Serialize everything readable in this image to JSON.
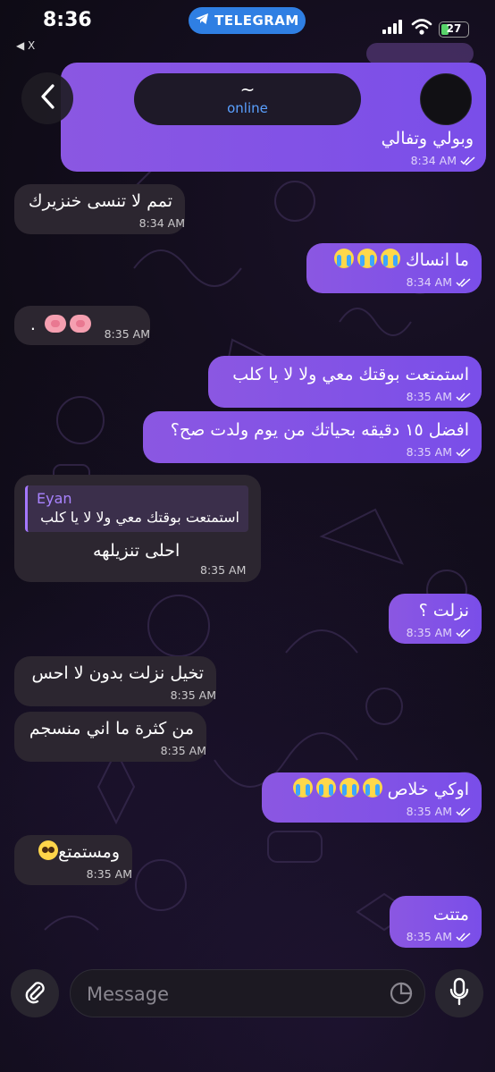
{
  "status_bar": {
    "time": "8:36",
    "back_label": "◀ X",
    "app_pill": "TELEGRAM",
    "battery": "27"
  },
  "header": {
    "contact_name": "~",
    "contact_status": "online"
  },
  "top_partial": {
    "text": "وبولي وتفالي",
    "time": "8:34 AM"
  },
  "messages": [
    {
      "dir": "in",
      "text": "تمم لا تنسى خنزيرك",
      "time": "8:34 AM"
    },
    {
      "dir": "out",
      "text": "ما انساك",
      "emoji": "crying-face x3",
      "time": "8:34 AM"
    },
    {
      "dir": "in",
      "text": ".",
      "emoji": "pig-nose x2",
      "time": "8:35 AM"
    },
    {
      "dir": "out",
      "text": "استمتعت بوقتك معي ولا لا يا كلب",
      "time": "8:35 AM"
    },
    {
      "dir": "out",
      "text": "افضل ١٥ دقيقه بحياتك من يوم ولدت صح؟",
      "time": "8:35 AM"
    },
    {
      "dir": "in",
      "reply_name": "Eyan",
      "reply_text": "استمتعت بوقتك معي ولا لا يا كلب",
      "text": "احلى تنزيلهه",
      "time": "8:35 AM"
    },
    {
      "dir": "out",
      "text": "نزلت ؟",
      "time": "8:35 AM"
    },
    {
      "dir": "in",
      "text": "تخيل نزلت بدون لا احس",
      "time": "8:35 AM"
    },
    {
      "dir": "in",
      "text": "من كثرة ما اني منسجم",
      "time": "8:35 AM"
    },
    {
      "dir": "out",
      "text": "اوكي خلاص",
      "emoji": "crying-face x4",
      "time": "8:35 AM"
    },
    {
      "dir": "in",
      "text": "ومستمتع",
      "emoji": "pleading-face",
      "time": "8:35 AM"
    },
    {
      "dir": "out",
      "text": "متتت",
      "time": "8:35 AM"
    }
  ],
  "composer": {
    "placeholder": "Message"
  },
  "colors": {
    "outgoing_bubble": "#8552e6",
    "incoming_bubble": "#2c2630",
    "accent_blue": "#2f7fe3",
    "online": "#5aa0ff"
  },
  "icons": [
    "telegram-plane-icon",
    "signal-icon",
    "wifi-icon",
    "battery-icon",
    "back-chevron-icon",
    "paperclip-icon",
    "sticker-icon",
    "microphone-icon",
    "double-check-icon"
  ]
}
